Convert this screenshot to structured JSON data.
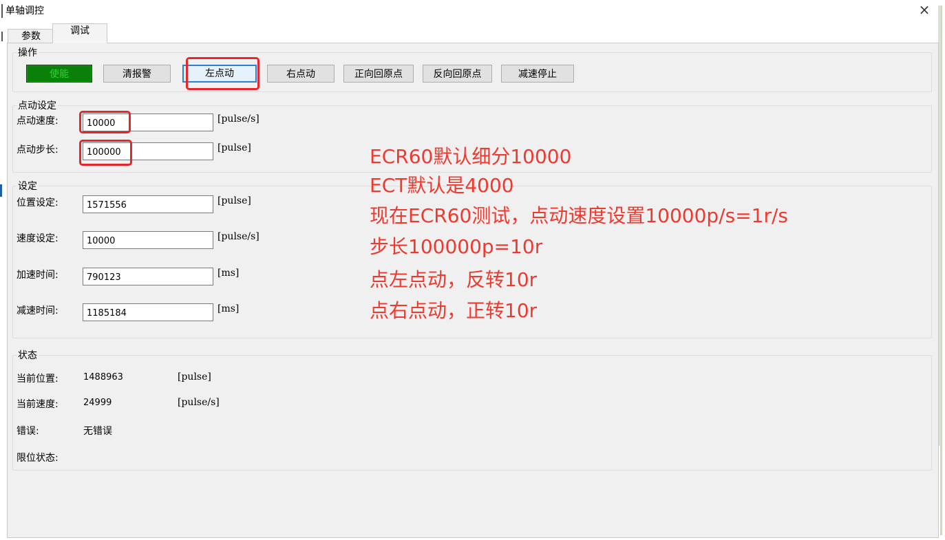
{
  "window": {
    "title": "单轴调控",
    "close_glyph": "×"
  },
  "tabs": [
    {
      "label": "参数"
    },
    {
      "label": "调试"
    }
  ],
  "operation": {
    "title": "操作",
    "buttons": [
      {
        "label": "使能"
      },
      {
        "label": "清报警"
      },
      {
        "label": "左点动"
      },
      {
        "label": "右点动"
      },
      {
        "label": "正向回原点"
      },
      {
        "label": "反向回原点"
      },
      {
        "label": "减速停止"
      }
    ]
  },
  "jog": {
    "title": "点动设定",
    "speed": {
      "label": "点动速度:",
      "value": "10000",
      "unit": "[pulse/s]"
    },
    "step": {
      "label": "点动步长:",
      "value": "100000",
      "unit": "[pulse]"
    }
  },
  "settings": {
    "title": "设定",
    "position": {
      "label": "位置设定:",
      "value": "1571556",
      "unit": "[pulse]"
    },
    "speed": {
      "label": "速度设定:",
      "value": "10000",
      "unit": "[pulse/s]"
    },
    "accel": {
      "label": "加速时间:",
      "value": "790123",
      "unit": "[ms]"
    },
    "decel": {
      "label": "减速时间:",
      "value": "1185184",
      "unit": "[ms]"
    }
  },
  "status": {
    "title": "状态",
    "position": {
      "label": "当前位置:",
      "value": "1488963",
      "unit": "[pulse]"
    },
    "speed": {
      "label": "当前速度:",
      "value": "24999",
      "unit": "[pulse/s]"
    },
    "error": {
      "label": "错误:",
      "value": "无错误"
    },
    "limit": {
      "label": "限位状态:"
    }
  },
  "annotations": [
    "ECR60默认细分10000",
    "ECT默认是4000",
    "现在ECR60测试，点动速度设置10000p/s=1r/s",
    "步长100000p=10r",
    "点左点动，反转10r",
    "点右点动，正转10r"
  ],
  "colors": {
    "annotation": "#f0392e",
    "highlight": "#e8262a",
    "enable_bg": "#0a7f0a",
    "enable_text": "#2fd52f"
  }
}
